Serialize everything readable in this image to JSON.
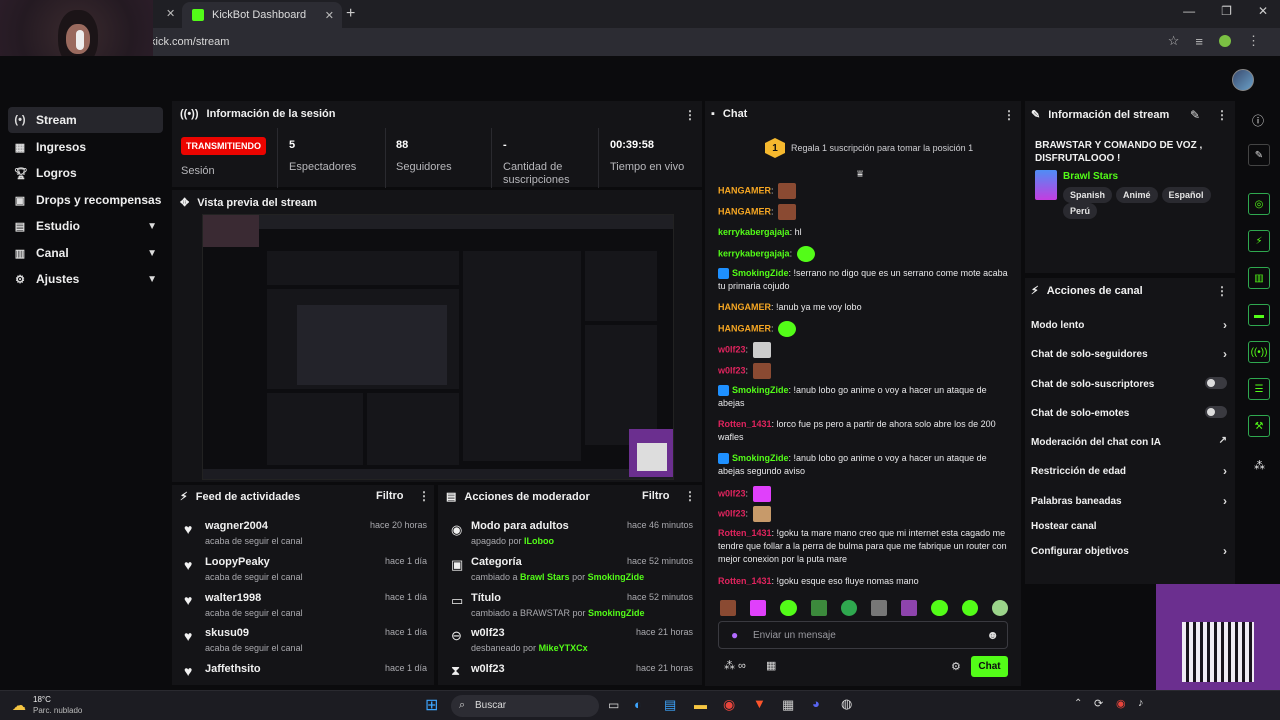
{
  "browser": {
    "tab_title": "KickBot Dashboard",
    "url": "kick.com/stream"
  },
  "sidebar": {
    "items": [
      {
        "label": "Stream",
        "icon": "stream-icon",
        "active": true
      },
      {
        "label": "Ingresos",
        "icon": "revenue-icon"
      },
      {
        "label": "Logros",
        "icon": "trophy-icon"
      },
      {
        "label": "Drops y recompensas",
        "icon": "gift-icon"
      },
      {
        "label": "Estudio",
        "icon": "studio-icon",
        "expandable": true
      },
      {
        "label": "Canal",
        "icon": "channel-icon",
        "expandable": true
      },
      {
        "label": "Ajustes",
        "icon": "gear-icon",
        "expandable": true
      }
    ]
  },
  "session": {
    "title": "Información de la sesión",
    "live_badge": "TRANSMITIENDO",
    "session_label": "Sesión",
    "stats": [
      {
        "value": "5",
        "label": "Espectadores"
      },
      {
        "value": "88",
        "label": "Seguidores"
      },
      {
        "value": "-",
        "label": "Cantidad de suscripciones"
      },
      {
        "value": "00:39:58",
        "label": "Tiempo en vivo"
      }
    ]
  },
  "preview": {
    "title": "Vista previa del stream"
  },
  "feed": {
    "title": "Feed de actividades",
    "filter": "Filtro",
    "items": [
      {
        "name": "wagner2004",
        "sub": "acaba de seguir el canal",
        "time": "hace 20 horas"
      },
      {
        "name": "LoopyPeaky",
        "sub": "acaba de seguir el canal",
        "time": "hace 1 día"
      },
      {
        "name": "walter1998",
        "sub": "acaba de seguir el canal",
        "time": "hace 1 día"
      },
      {
        "name": "skusu09",
        "sub": "acaba de seguir el canal",
        "time": "hace 1 día"
      },
      {
        "name": "Jaffethsito",
        "sub": "",
        "time": "hace 1 día"
      }
    ]
  },
  "mod": {
    "title": "Acciones de moderador",
    "filter": "Filtro",
    "items": [
      {
        "name": "Modo para adultos",
        "pre": "apagado por ",
        "hl1": "ILoboo",
        "mid": "",
        "hl2": "",
        "time": "hace 46 minutos",
        "icon": "eye-icon"
      },
      {
        "name": "Categoría",
        "pre": "cambiado a ",
        "hl1": "Brawl Stars",
        "mid": " por ",
        "hl2": "SmokingZide",
        "time": "hace 52 minutos",
        "icon": "category-icon"
      },
      {
        "name": "Título",
        "pre": "cambiado a BRAWSTAR por ",
        "hl1": "SmokingZide",
        "mid": "",
        "hl2": "",
        "time": "hace 52 minutos",
        "icon": "title-icon"
      },
      {
        "name": "w0lf23",
        "pre": "desbaneado por ",
        "hl1": "MikeYTXCx",
        "mid": "",
        "hl2": "",
        "time": "hace 21 horas",
        "icon": "unban-icon"
      },
      {
        "name": "w0lf23",
        "pre": "",
        "hl1": "",
        "mid": "",
        "hl2": "",
        "time": "hace 21 horas",
        "icon": "timer-icon"
      }
    ]
  },
  "chat": {
    "title": "Chat",
    "gift_count": "1",
    "gift_text": "Regala 1 suscripción para tomar la posición 1",
    "messages": [
      {
        "user": "HANGAMER",
        "color": "#f5a623",
        "text": "",
        "emote": "#8a4a32"
      },
      {
        "user": "HANGAMER",
        "color": "#f5a623",
        "text": "",
        "emote": "#8a4a32"
      },
      {
        "user": "kerrykabergajaja",
        "color": "#53fc18",
        "text": "hl",
        "emote": ""
      },
      {
        "user": "kerrykabergajaja",
        "color": "#53fc18",
        "text": "",
        "emote": "#53fc18"
      },
      {
        "user": "SmokingZide",
        "color": "#53fc18",
        "badge": true,
        "text": "!serrano no digo que es un serrano come mote acaba tu primaria cojudo",
        "emote": ""
      },
      {
        "user": "HANGAMER",
        "color": "#f5a623",
        "text": "!anub ya me voy lobo",
        "emote": ""
      },
      {
        "user": "HANGAMER",
        "color": "#f5a623",
        "text": "",
        "emote": "#53fc18"
      },
      {
        "user": "w0lf23",
        "color": "#e0245e",
        "text": "",
        "emote": "#cccccc"
      },
      {
        "user": "w0lf23",
        "color": "#e0245e",
        "text": "",
        "emote": "#8a4a32"
      },
      {
        "user": "SmokingZide",
        "color": "#53fc18",
        "badge": true,
        "text": "!anub lobo go anime o voy a hacer un ataque de abejas",
        "emote": ""
      },
      {
        "user": "Rotten_1431",
        "color": "#e0245e",
        "text": "lorco fue ps pero a partir de ahora solo abre los de 200 wafles",
        "emote": ""
      },
      {
        "user": "SmokingZide",
        "color": "#53fc18",
        "badge": true,
        "text": "!anub lobo go anime o voy a hacer un ataque de abejas segundo aviso",
        "emote": ""
      },
      {
        "user": "w0lf23",
        "color": "#e0245e",
        "text": "",
        "emote": "#e040fb"
      },
      {
        "user": "w0lf23",
        "color": "#e0245e",
        "text": "",
        "emote": "#c79a6a"
      },
      {
        "user": "Rotten_1431",
        "color": "#e0245e",
        "text": "!goku ta mare mano creo que mi internet esta cagado me tendre que follar a la perra de bulma para que me fabrique un router con mejor conexion por la puta mare",
        "emote": ""
      },
      {
        "user": "Rotten_1431",
        "color": "#e0245e",
        "text": "!goku esque eso fluye nomas mano",
        "emote": ""
      }
    ],
    "input_placeholder": "Enviar un mensaje",
    "send_label": "Chat"
  },
  "stream_info": {
    "title": "Información del stream",
    "stream_title": "BRAWSTAR Y COMANDO DE VOZ , DISFRUTALOOO !",
    "category": "Brawl Stars",
    "tags": [
      "Spanish",
      "Animé",
      "Español",
      "Perú"
    ]
  },
  "channel_actions": {
    "title": "Acciones de canal",
    "items": [
      {
        "label": "Modo lento",
        "kind": "arrow"
      },
      {
        "label": "Chat de solo-seguidores",
        "kind": "arrow"
      },
      {
        "label": "Chat de solo-suscriptores",
        "kind": "toggle"
      },
      {
        "label": "Chat de solo-emotes",
        "kind": "toggle"
      },
      {
        "label": "Moderación del chat con IA",
        "kind": "external"
      },
      {
        "label": "Restricción de edad",
        "kind": "arrow"
      },
      {
        "label": "Palabras baneadas",
        "kind": "arrow"
      },
      {
        "label": "Hostear canal",
        "kind": "none"
      },
      {
        "label": "Configurar objetivos",
        "kind": "arrow"
      }
    ]
  },
  "taskbar": {
    "weather_temp": "18°C",
    "weather_desc": "Parc. nublado",
    "search": "Buscar"
  },
  "colors": {
    "accent": "#53fc18",
    "live": "#eb0400",
    "panel": "#141417"
  }
}
